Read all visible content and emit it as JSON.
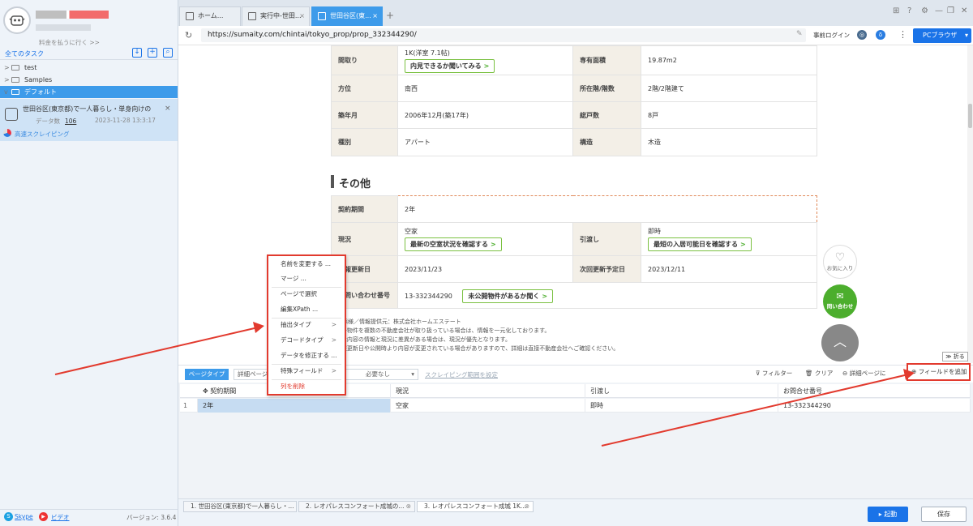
{
  "sidebar": {
    "pay_link": "料金を払うに行く >>",
    "task_section_title": "全てのタスク",
    "folders": [
      {
        "label": "test",
        "chevron": ">"
      },
      {
        "label": "Samples",
        "chevron": ">"
      },
      {
        "label": "デフォルト",
        "chevron": "v"
      }
    ],
    "task": {
      "name": "世田谷区(東京都)で一人暮らし・単身向けの",
      "count_label": "データ数",
      "count_value": "106",
      "timestamp": "2023-11-28 13:3:17",
      "mode_link": "高速スクレイピング"
    },
    "footer": {
      "skype": "Skype",
      "video": "ビデオ",
      "version": "バージョン: 3.6.4"
    }
  },
  "browser": {
    "tabs": [
      {
        "label": "ホーム..."
      },
      {
        "label": "実行中-世田..."
      },
      {
        "label": "世田谷区(東..."
      }
    ],
    "url": "https://sumaity.com/chintai/tokyo_prop/prop_332344290/",
    "login_label": "事前ログイン",
    "mode_button": "PCブラウザ"
  },
  "page": {
    "top_table": [
      {
        "label1": "間取り",
        "value1": "1K(洋室 7.1帖)",
        "button1": "内見できるか聞いてみる",
        "label2": "専有面積",
        "value2": "19.87m2"
      },
      {
        "label1": "方位",
        "value1": "南西",
        "label2": "所在階/階数",
        "value2": "2階/2階建て"
      },
      {
        "label1": "築年月",
        "value1": "2006年12月(築17年)",
        "label2": "総戸数",
        "value2": "8戸"
      },
      {
        "label1": "種別",
        "value1": "アパート",
        "label2": "構造",
        "value2": "木造"
      }
    ],
    "section_title": "その他",
    "contract": {
      "label": "契約期間",
      "value": "2年"
    },
    "status_row": {
      "label1": "現況",
      "value1": "空家",
      "button1": "最新の空室状況を確認する",
      "label2": "引渡し",
      "value2": "即時",
      "button2": "最短の入居可能日を確認する"
    },
    "update_row": {
      "label1": "情報更新日",
      "value1": "2023/11/23",
      "label2": "次回更新予定日",
      "value2": "2023/12/11"
    },
    "inquiry_row": {
      "label1": "お問い合わせ番号",
      "value1": "13-332344290",
      "button1": "未公開物件があるか聞く"
    },
    "notes": [
      "取引態様／情報提供元：株式会社ホームエステート",
      "※同一物件を複数の不動産会社が取り扱っている場合は、情報を一元化しております。",
      "※表示内容の情報と現況に差異がある場合は、現況が優先となります。",
      "※情報更新日や公開時より内容が変更されている場合がありますので、詳細は直接不動産会社へご確認ください。"
    ],
    "fav_label": "お気に入り",
    "contact_label": "問い合わせ",
    "fold_label": "折る"
  },
  "toolbar": {
    "page_type": "ページタイプ",
    "detail_select": "詳細ページ",
    "need_select": "必要なし",
    "scope_link": "スクレイピング範囲を設定",
    "filter": "フィルター",
    "clear": "クリア",
    "detail_page": "詳細ページに",
    "add_field": "フィールドを追加"
  },
  "grid": {
    "columns": [
      "契約期間",
      "現況",
      "引渡し",
      "お問合せ番号"
    ],
    "rows": [
      {
        "index": "1",
        "cells": [
          "2年",
          "空家",
          "即時",
          "13-332344290"
        ]
      }
    ]
  },
  "context_menu": {
    "rename": "名前を変更する ...",
    "merge": "マージ ...",
    "select_in_page": "ページで選択",
    "edit_xpath": "編集XPath ...",
    "extract_type": "抽出タイプ",
    "decode_type": "デコードタイプ",
    "fix_data": "データを修正する ...",
    "special_field": "特殊フィールド",
    "delete_column": "列を削除"
  },
  "bottom": {
    "tasks": [
      {
        "label": "1. 世田谷区(東京都)で一人暮らし・..."
      },
      {
        "label": "2. レオパレスコンフォート成城の..."
      },
      {
        "label": "3. レオパレスコンフォート成城 1K..."
      }
    ],
    "run": "起動",
    "save": "保存"
  },
  "colors": {
    "accent": "#1a73e8",
    "tab_active": "#3d9bea",
    "highlight": "#e23a2e",
    "green": "#4cae2d"
  }
}
